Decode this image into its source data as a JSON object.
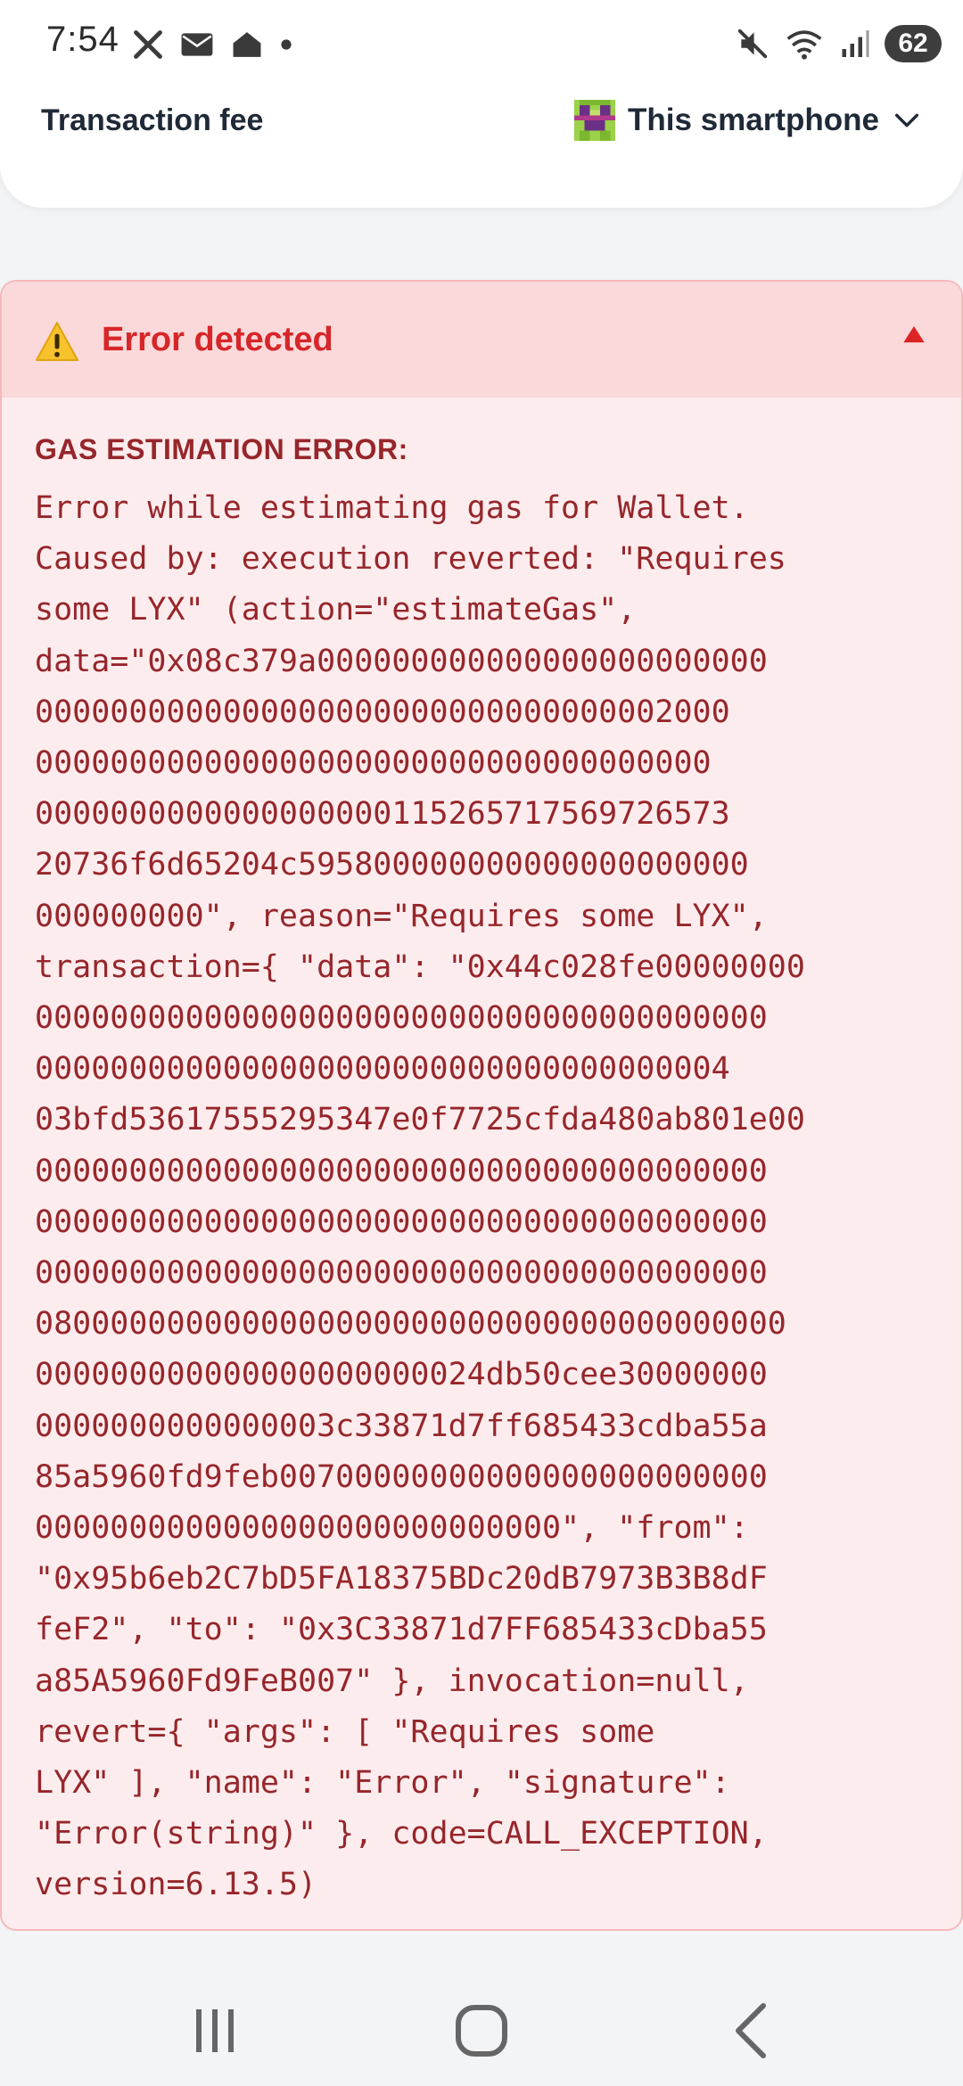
{
  "status_bar": {
    "time": "7:54",
    "left_icons": [
      "x-logo-icon",
      "mail-icon",
      "home-icon",
      "dot-icon"
    ],
    "right_icons": [
      "mute-icon",
      "wifi-icon",
      "signal-icon"
    ],
    "battery": "62"
  },
  "fee_row": {
    "label": "Transaction fee",
    "device_label": "This smartphone"
  },
  "error": {
    "title": "Error detected",
    "kind": "GAS ESTIMATION ERROR:",
    "lines": [
      "Error while estimating gas for Wallet.",
      "Caused by: execution reverted: \"Requires",
      "some LYX\" (action=\"estimateGas\",",
      "data=\"0x08c379a000000000000000000000000",
      "0000000000000000000000000000000002000",
      "000000000000000000000000000000000000",
      "0000000000000000000115265717569726573",
      "20736f6d65204c595800000000000000000000",
      "000000000\", reason=\"Requires some LYX\",",
      "transaction={ \"data\": \"0x44c028fe00000000",
      "000000000000000000000000000000000000000",
      "0000000000000000000000000000000000004",
      "03bfd53617555295347e0f7725cfda480ab801e00",
      "000000000000000000000000000000000000000",
      "000000000000000000000000000000000000000",
      "000000000000000000000000000000000000000",
      "0800000000000000000000000000000000000000",
      "000000000000000000000024db50cee30000000",
      "0000000000000003c33871d7ff685433cdba55a",
      "85a5960fd9feb00700000000000000000000000",
      "0000000000000000000000000000\", \"from\":",
      "\"0x95b6eb2C7bD5FA18375BDc20dB7973B3B8dF",
      "feF2\", \"to\": \"0x3C33871d7FF685433cDba55",
      "a85A5960Fd9FeB007\" }, invocation=null,",
      "revert={ \"args\": [ \"Requires some",
      "LYX\" ], \"name\": \"Error\", \"signature\":",
      "\"Error(string)\" }, code=CALL_EXCEPTION,",
      "version=6.13.5)"
    ]
  },
  "colors": {
    "error_text": "#96262b",
    "error_title": "#d6262a",
    "error_bg": "#fdeced",
    "error_header_bg": "#fbd9da"
  }
}
